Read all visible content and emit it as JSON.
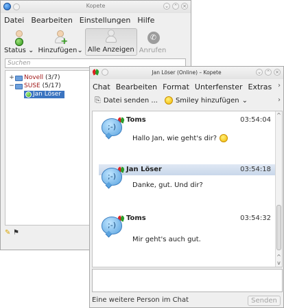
{
  "main_window": {
    "title": "Kopete",
    "menu": [
      "Datei",
      "Bearbeiten",
      "Einstellungen",
      "Hilfe"
    ],
    "toolbar": {
      "status": "Status",
      "add": "Hinzufügen",
      "show_all": "Alle Anzeigen",
      "call": "Anrufen"
    },
    "search_placeholder": "Suchen",
    "groups": [
      {
        "name": "Novell",
        "count": "(3/7)",
        "expander": "+"
      },
      {
        "name": "SUSE",
        "count": "(5/17)",
        "expander": "−"
      }
    ],
    "selected_contact": "Jan Löser"
  },
  "chat_window": {
    "title": "Jan Löser (Online) – Kopete",
    "menu": [
      "Chat",
      "Bearbeiten",
      "Format",
      "Unterfenster",
      "Extras"
    ],
    "menu_more": "›",
    "toolbar": {
      "send_file": "Datei senden ...",
      "add_smiley": "Smiley hinzufügen"
    },
    "messages": [
      {
        "sender": "Toms",
        "time": "03:54:04",
        "text": "Hallo Jan, wie geht's dir?",
        "smiley": true
      },
      {
        "sender": "Jan Löser",
        "time": "03:54:18",
        "text": "Danke, gut. Und dir?",
        "smiley": false
      },
      {
        "sender": "Toms",
        "time": "03:54:32",
        "text": "Mir geht's auch gut.",
        "smiley": false
      }
    ],
    "status_text": "Eine weitere Person im Chat",
    "send_button": "Senden"
  },
  "colors": {
    "selection": "#3b74c0",
    "group_label": "#a11818",
    "highlight_header": "#c9d7ea"
  }
}
